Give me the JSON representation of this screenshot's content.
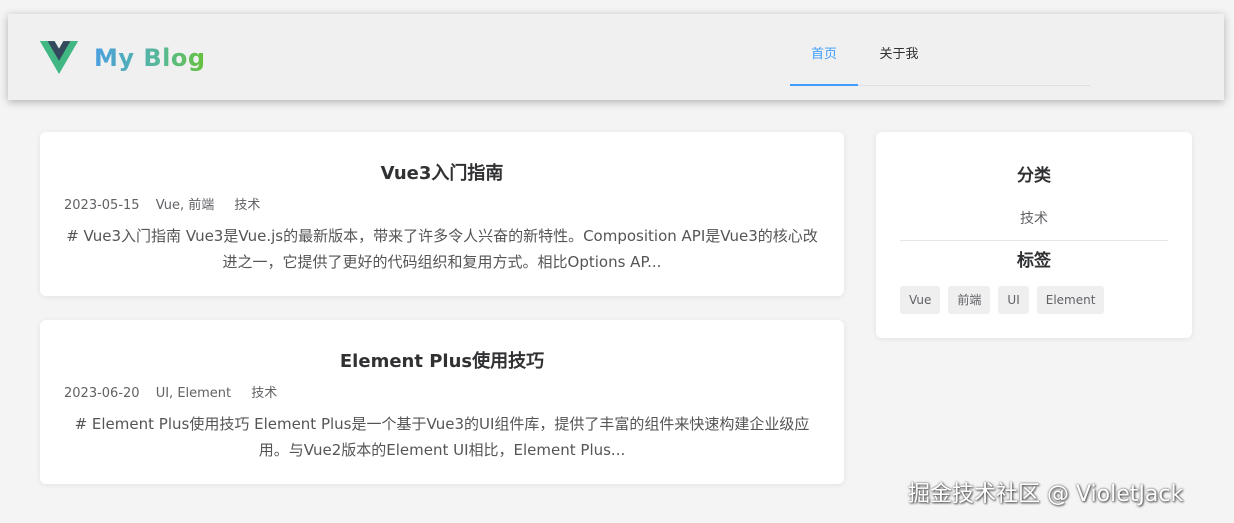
{
  "header": {
    "brand": "My Blog",
    "nav": [
      {
        "label": "首页",
        "active": true
      },
      {
        "label": "关于我",
        "active": false
      }
    ]
  },
  "posts": [
    {
      "title": "Vue3入门指南",
      "date": "2023-05-15",
      "tags": "Vue, 前端",
      "category": "技术",
      "excerpt": "# Vue3入门指南 Vue3是Vue.js的最新版本，带来了许多令人兴奋的新特性。Composition API是Vue3的核心改进之一，它提供了更好的代码组织和复用方式。相比Options AP..."
    },
    {
      "title": "Element Plus使用技巧",
      "date": "2023-06-20",
      "tags": "UI, Element",
      "category": "技术",
      "excerpt": "# Element Plus使用技巧 Element Plus是一个基于Vue3的UI组件库，提供了丰富的组件来快速构建企业级应用。与Vue2版本的Element UI相比，Element Plus..."
    }
  ],
  "sidebar": {
    "categories_title": "分类",
    "categories": [
      "技术"
    ],
    "tags_title": "标签",
    "tags": [
      "Vue",
      "前端",
      "UI",
      "Element"
    ]
  },
  "watermark": "掘金技术社区 @ VioletJack",
  "colors": {
    "accent": "#409eff",
    "logo_green": "#41b883",
    "logo_dark": "#35495e"
  }
}
